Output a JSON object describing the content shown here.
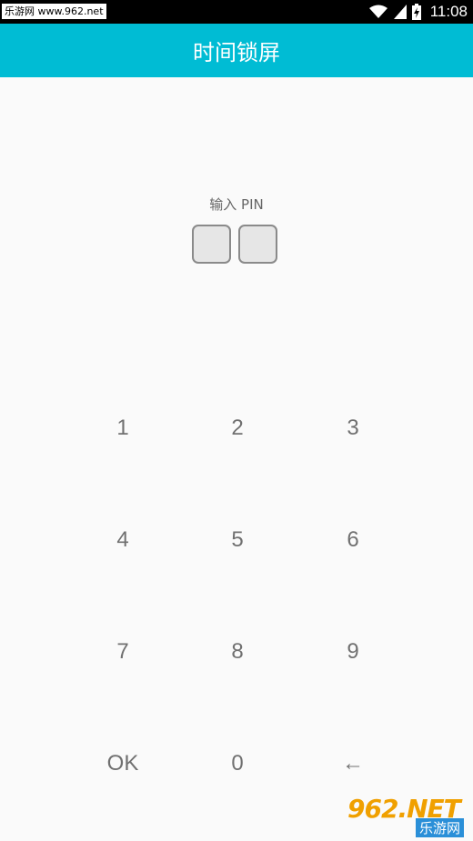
{
  "status_bar": {
    "watermark": "乐游网 www.962.net",
    "time": "11:08",
    "icons": [
      "wifi-icon",
      "signal-icon",
      "battery-charging-icon"
    ]
  },
  "app_bar": {
    "title": "时间锁屏"
  },
  "pin": {
    "label": "输入 PIN",
    "entered_digits": 2
  },
  "keypad": {
    "keys": [
      "1",
      "2",
      "3",
      "4",
      "5",
      "6",
      "7",
      "8",
      "9",
      "OK",
      "0",
      "←"
    ]
  },
  "logo": {
    "main": "962.NET",
    "sub": "乐游网"
  },
  "colors": {
    "accent": "#00bcd4",
    "background": "#fafafa",
    "key_text": "#707070"
  }
}
